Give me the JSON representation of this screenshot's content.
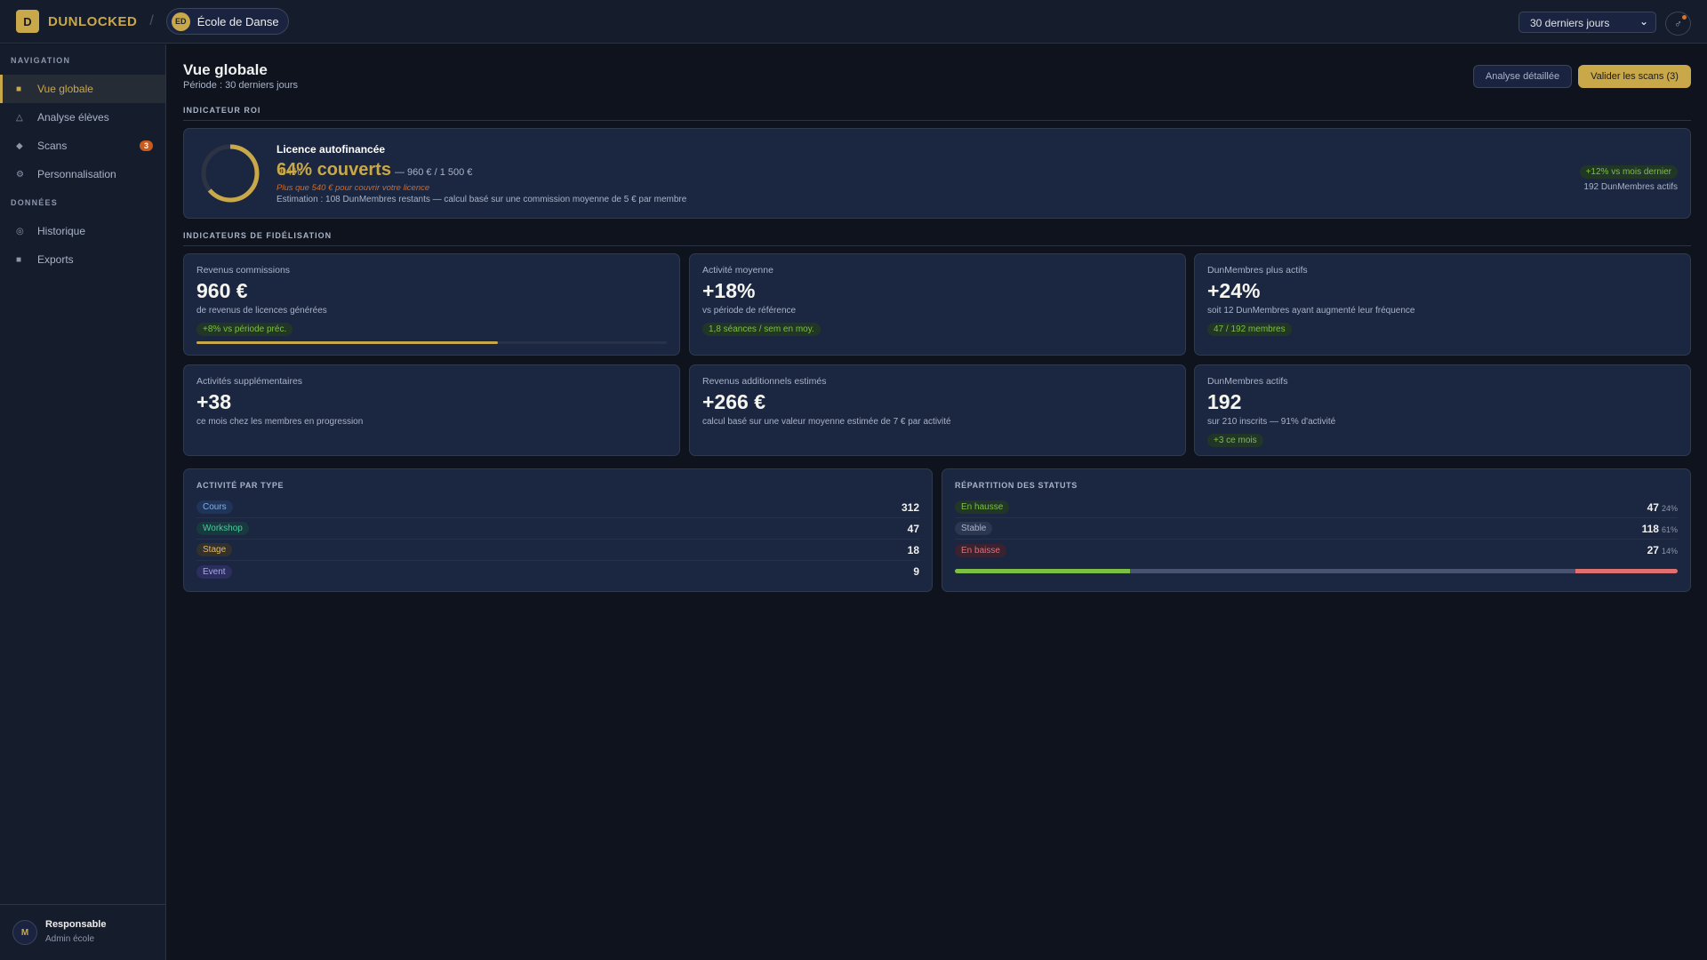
{
  "topbar": {
    "logo_letter": "D",
    "brand": "DUNLOCKED",
    "school_initials": "ED",
    "school_name": "École de Danse",
    "period_select": "30 derniers jours",
    "notification_icon": "user-icon"
  },
  "sidebar": {
    "section_nav": "NAVIGATION",
    "section_data": "DONNÉES",
    "nav": [
      {
        "label": "Vue globale",
        "icon": "■"
      },
      {
        "label": "Analyse élèves",
        "icon": "△"
      },
      {
        "label": "Scans",
        "icon": "◆",
        "badge": "3"
      },
      {
        "label": "Personnalisation",
        "icon": "⚙"
      }
    ],
    "data_items": [
      {
        "label": "Historique",
        "icon": "◎"
      },
      {
        "label": "Exports",
        "icon": "■"
      }
    ],
    "user": {
      "initial": "M",
      "name": "Responsable",
      "role": "Admin école"
    }
  },
  "header": {
    "title": "Vue globale",
    "subtitle": "Période : 30 derniers jours",
    "btn_analysis": "Analyse détaillée",
    "btn_validate": "Valider les scans (3)"
  },
  "roi": {
    "section": "INDICATEUR ROI",
    "percent": 64,
    "ring_label": "64%",
    "title": "Licence autofinancée",
    "headline": "64% couverts",
    "amounts": "— 960 € / 1 500 €",
    "warning": "Plus que 540 € pour couvrir votre licence",
    "estimate": "Estimation : 108 DunMembres restants — calcul basé sur une commission moyenne de 5 € par membre",
    "trend": "+12% vs mois dernier",
    "active": "192 DunMembres actifs"
  },
  "fidelity": {
    "section": "INDICATEURS DE FIDÉLISATION",
    "cards": [
      {
        "label": "Revenus commissions",
        "value": "960 €",
        "desc": "de revenus de licences générées",
        "pill": "+8% vs période préc.",
        "progress": 64
      },
      {
        "label": "Activité moyenne",
        "value": "+18%",
        "desc": "vs période de référence",
        "pill": "1,8 séances / sem en moy."
      },
      {
        "label": "DunMembres plus actifs",
        "value": "+24%",
        "desc": "soit 12 DunMembres ayant augmenté leur fréquence",
        "pill": "47 / 192 membres"
      },
      {
        "label": "Activités supplémentaires",
        "value": "+38",
        "desc": "ce mois chez les membres en progression"
      },
      {
        "label": "Revenus additionnels estimés",
        "value": "+266 €",
        "desc": "calcul basé sur une valeur moyenne estimée de 7 € par activité"
      },
      {
        "label": "DunMembres actifs",
        "value": "192",
        "desc": "sur 210 inscrits — 91% d'activité",
        "pill": "+3 ce mois"
      }
    ]
  },
  "activity": {
    "title": "ACTIVITÉ PAR TYPE",
    "rows": [
      {
        "label": "Cours",
        "value": "312",
        "bg": "#1f3458",
        "fg": "#7fb0ea"
      },
      {
        "label": "Workshop",
        "value": "47",
        "bg": "#173a3e",
        "fg": "#4fc8a0"
      },
      {
        "label": "Stage",
        "value": "18",
        "bg": "#33312e",
        "fg": "#e8b860"
      },
      {
        "label": "Event",
        "value": "9",
        "bg": "#2c2f5e",
        "fg": "#a8a8ea"
      }
    ]
  },
  "statuses": {
    "title": "RÉPARTITION DES STATUTS",
    "rows": [
      {
        "label": "En hausse",
        "value": "47",
        "pct": "24%",
        "share": 24,
        "bg": "#223627",
        "fg": "#7bc043",
        "bar": "#7bc043"
      },
      {
        "label": "Stable",
        "value": "118",
        "pct": "61%",
        "share": 61,
        "bg": "#2b3650",
        "fg": "#a9b3c8",
        "bar": "#475370"
      },
      {
        "label": "En baisse",
        "value": "27",
        "pct": "14%",
        "share": 14,
        "bg": "#3a2230",
        "fg": "#e07070",
        "bar": "#e07070"
      }
    ]
  }
}
